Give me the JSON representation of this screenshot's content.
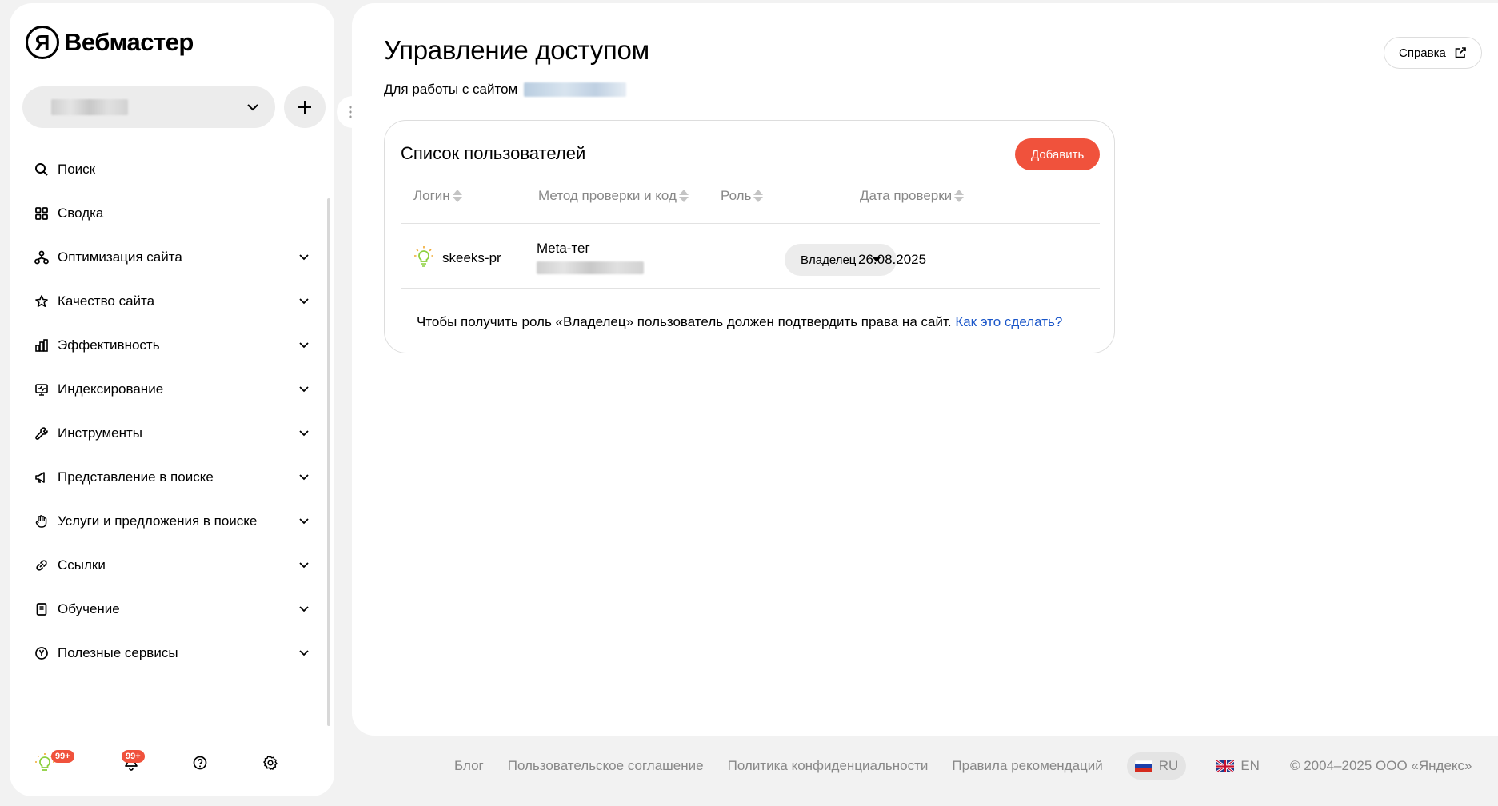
{
  "app": {
    "brand_letter": "Я",
    "brand_name": "Вебмастер"
  },
  "sidebar": {
    "site_select": {
      "value": ""
    },
    "items": [
      {
        "label": "Поиск",
        "icon": "search-icon",
        "expandable": false
      },
      {
        "label": "Сводка",
        "icon": "dashboard-icon",
        "expandable": false
      },
      {
        "label": "Оптимизация сайта",
        "icon": "sitemap-icon",
        "expandable": true
      },
      {
        "label": "Качество сайта",
        "icon": "star-icon",
        "expandable": true
      },
      {
        "label": "Эффективность",
        "icon": "bar-chart-icon",
        "expandable": true
      },
      {
        "label": "Индексирование",
        "icon": "monitor-icon",
        "expandable": true
      },
      {
        "label": "Инструменты",
        "icon": "wrench-icon",
        "expandable": true
      },
      {
        "label": "Представление в поиске",
        "icon": "megaphone-icon",
        "expandable": true
      },
      {
        "label": "Услуги и предложения в поиске",
        "icon": "hand-icon",
        "expandable": true
      },
      {
        "label": "Ссылки",
        "icon": "link-icon",
        "expandable": true
      },
      {
        "label": "Обучение",
        "icon": "book-icon",
        "expandable": true
      },
      {
        "label": "Полезные сервисы",
        "icon": "yandex-circle-icon",
        "expandable": true
      }
    ],
    "bottom": {
      "tips_badge": "99+",
      "notifications_badge": "99+"
    }
  },
  "main": {
    "title": "Управление доступом",
    "subtitle": "Для работы с сайтом",
    "help_label": "Справка",
    "users": {
      "title": "Список пользователей",
      "add_label": "Добавить",
      "columns": [
        "Логин",
        "Метод проверки и код",
        "Роль",
        "Дата проверки"
      ],
      "rows": [
        {
          "login": "skeeks-pr",
          "method": "Meta-тег",
          "role": "Владелец",
          "date": "26.08.2025"
        }
      ],
      "note": "Чтобы получить роль «Владелец» пользователь должен подтвердить права на сайт.",
      "note_link": "Как это сделать?"
    }
  },
  "footer": {
    "links": [
      "Блог",
      "Пользовательское соглашение",
      "Политика конфиденциальности",
      "Правила рекомендаций"
    ],
    "lang_ru": "RU",
    "lang_en": "EN",
    "copyright": "© 2004–2025 ООО «Яндекс»"
  },
  "colors": {
    "accent": "#f0523c",
    "link": "#1a56c9",
    "bg": "#f2f2f2"
  }
}
